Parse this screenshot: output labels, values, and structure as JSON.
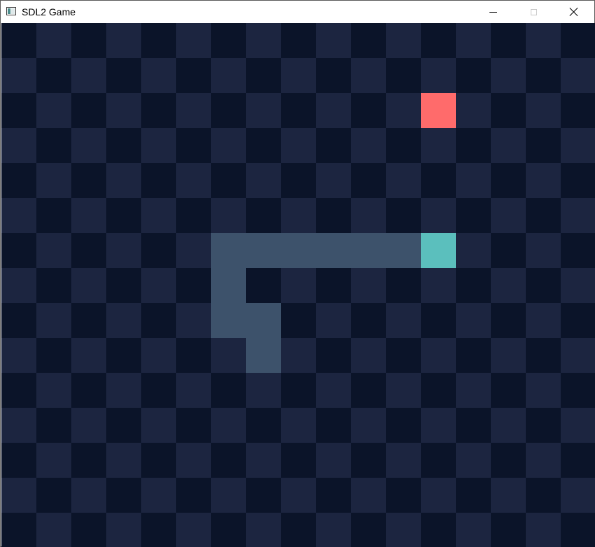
{
  "window": {
    "title": "SDL2 Game",
    "controls": {
      "minimize": "minimize",
      "maximize": "maximize",
      "close": "close"
    }
  },
  "game": {
    "type": "snake",
    "grid": {
      "cols": 17,
      "rows": 15
    },
    "colors": {
      "tile_dark": "#0b1429",
      "tile_light": "#1c2540",
      "snake_body": "#3d526b",
      "snake_head": "#5bbfbd",
      "food": "#ff6b6b"
    },
    "food": {
      "col": 12,
      "row": 2
    },
    "snake": [
      {
        "col": 12,
        "row": 6
      },
      {
        "col": 11,
        "row": 6
      },
      {
        "col": 10,
        "row": 6
      },
      {
        "col": 9,
        "row": 6
      },
      {
        "col": 8,
        "row": 6
      },
      {
        "col": 7,
        "row": 6
      },
      {
        "col": 6,
        "row": 6
      },
      {
        "col": 6,
        "row": 7
      },
      {
        "col": 6,
        "row": 8
      },
      {
        "col": 7,
        "row": 8
      },
      {
        "col": 7,
        "row": 9
      }
    ]
  }
}
